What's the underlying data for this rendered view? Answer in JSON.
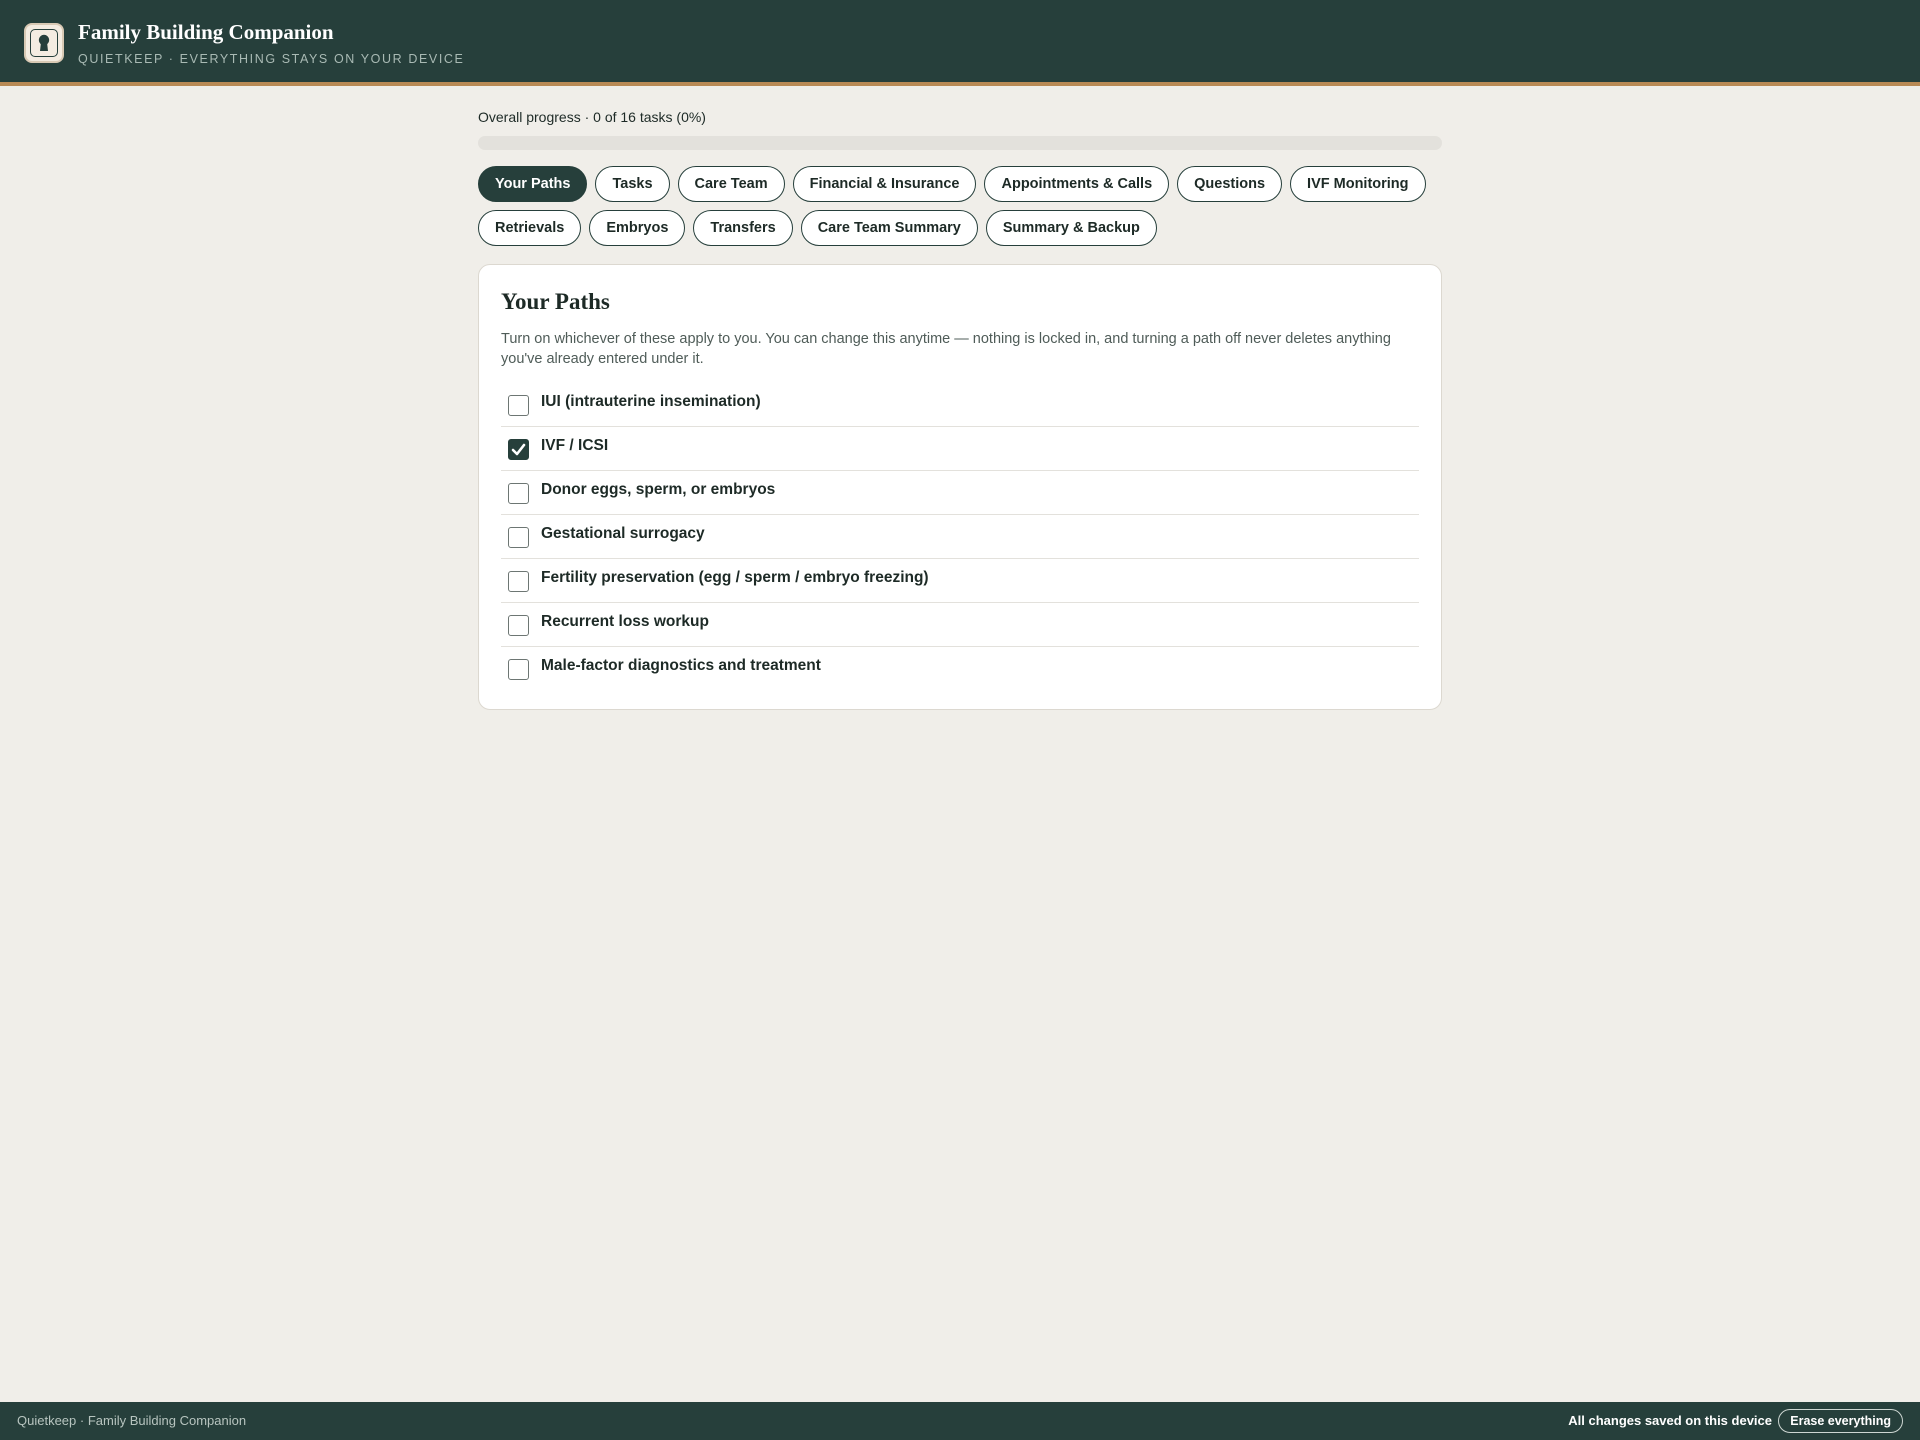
{
  "header": {
    "title": "Family Building Companion",
    "subtitle": "QUIETKEEP · EVERYTHING STAYS ON YOUR DEVICE",
    "logo_icon": "keyhole-icon"
  },
  "progress": {
    "label": "Overall progress · 0 of 16 tasks (0%)",
    "done": 0,
    "total": 16,
    "percent": 0
  },
  "tabs": [
    {
      "label": "Your Paths",
      "active": true
    },
    {
      "label": "Tasks",
      "active": false
    },
    {
      "label": "Care Team",
      "active": false
    },
    {
      "label": "Financial & Insurance",
      "active": false
    },
    {
      "label": "Appointments & Calls",
      "active": false
    },
    {
      "label": "Questions",
      "active": false
    },
    {
      "label": "IVF Monitoring",
      "active": false
    },
    {
      "label": "Retrievals",
      "active": false
    },
    {
      "label": "Embryos",
      "active": false
    },
    {
      "label": "Transfers",
      "active": false
    },
    {
      "label": "Care Team Summary",
      "active": false
    },
    {
      "label": "Summary & Backup",
      "active": false
    }
  ],
  "card": {
    "title": "Your Paths",
    "description": "Turn on whichever of these apply to you. You can change this anytime — nothing is locked in, and turning a path off never deletes anything you've already entered under it.",
    "paths": [
      {
        "label": "IUI (intrauterine insemination)",
        "checked": false
      },
      {
        "label": "IVF / ICSI",
        "checked": true
      },
      {
        "label": "Donor eggs, sperm, or embryos",
        "checked": false
      },
      {
        "label": "Gestational surrogacy",
        "checked": false
      },
      {
        "label": "Fertility preservation (egg / sperm / embryo freezing)",
        "checked": false
      },
      {
        "label": "Recurrent loss workup",
        "checked": false
      },
      {
        "label": "Male-factor diagnostics and treatment",
        "checked": false
      }
    ]
  },
  "footer": {
    "left_text": "Quietkeep · Family Building Companion",
    "status": "All changes saved on this device",
    "erase_label": "Erase everything"
  },
  "colors": {
    "header_bg": "#263f3b",
    "accent_rule": "#b98a55",
    "page_bg": "#f0eee9"
  }
}
